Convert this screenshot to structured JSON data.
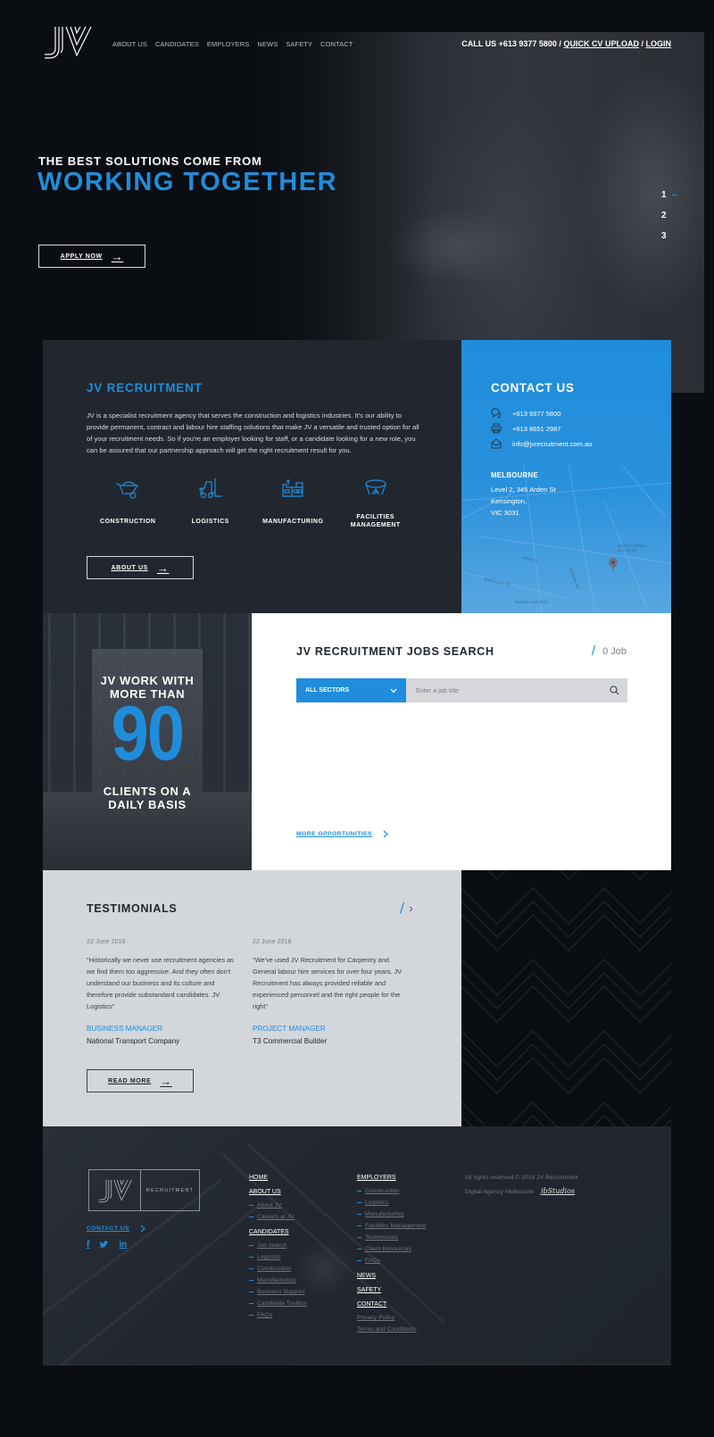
{
  "header": {
    "logo_text": "JV",
    "nav": [
      "ABOUT US",
      "CANDIDATES",
      "EMPLOYERS",
      "NEWS",
      "SAFETY",
      "CONTACT"
    ],
    "call_label": "CALL US +613 9377 5800",
    "separator": "/",
    "quick_cv_label": "QUICK CV UPLOAD",
    "login_label": "LOGIN"
  },
  "hero": {
    "subtitle": "THE BEST SOLUTIONS COME FROM",
    "title": "WORKING TOGETHER",
    "apply_label": "APPLY NOW",
    "slides": [
      "1",
      "2",
      "3"
    ],
    "active_slide": 1
  },
  "about": {
    "title": "JV RECRUITMENT",
    "text": "JV is a specialist recruitment agency that serves the construction and logistics industries. It's our ability to provide permanent, contract and labour hire staffing solutions that make JV a versatile and trusted option for all of your recruitment needs. So if you're an employer looking for staff, or a candidate looking for a new role, you can be assured that our partnership approach will get the right recruitment result for you.",
    "sectors": [
      {
        "label": "CONSTRUCTION",
        "icon": "wheelbarrow-icon"
      },
      {
        "label": "LOGISTICS",
        "icon": "forklift-icon"
      },
      {
        "label": "MANUFACTURING",
        "icon": "factory-icon"
      },
      {
        "label": "FACILITIES MANAGEMENT",
        "icon": "facilities-icon"
      }
    ],
    "button_label": "ABOUT US"
  },
  "contact": {
    "title": "CONTACT US",
    "phone": "+613 9377 5800",
    "fax": "+613 8651 2987",
    "email": "info@jvrecruitment.com.au",
    "city": "MELBOURNE",
    "address": [
      "Level 2, 345 Arden St",
      "Kensington,",
      "VIC 3031"
    ],
    "map_labels": [
      "Northern Brakes and Clutch",
      "Wishart Auto Tech",
      "Bakehouse Rd",
      "McClure Rd",
      "Arden St"
    ]
  },
  "stats": {
    "top": [
      "JV WORK WITH",
      "MORE THAN"
    ],
    "number": "90",
    "bottom": [
      "CLIENTS ON A",
      "DAILY BASIS"
    ]
  },
  "jobs": {
    "title": "JV RECRUITMENT JOBS SEARCH",
    "count": "0 Job",
    "sector_select": "ALL SECTORS",
    "search_placeholder": "Enter a job title",
    "search_value": "",
    "more_label": "MORE OPPORTUNITIES"
  },
  "testimonials": {
    "title": "TESTIMONIALS",
    "items": [
      {
        "date": "22 June 2016",
        "quote": "\"Historically we never use recruitment agencies as we find them too aggressive. And they often don't understand our business and its culture and therefore provide substandard candidates. JV Logistics\"",
        "role": "BUSINESS MANAGER",
        "company": "National Transport Company"
      },
      {
        "date": "22 June 2016",
        "quote": "\"We've used JV Recruitment for Carpentry and General labour hire services for over four years. JV Recruitment has always provided reliable and experienced personnel and the right people for the right\"",
        "role": "PROJECT MANAGER",
        "company": "T3 Commercial Builder"
      }
    ],
    "read_more_label": "READ MORE"
  },
  "footer": {
    "logo_word": "RECRUITMENT",
    "contact_label": "CONTACT US",
    "socials": [
      "f",
      "t",
      "in"
    ],
    "col1": {
      "home": "HOME",
      "about": "ABOUT US",
      "about_items": [
        "About JV",
        "Careers at JV"
      ],
      "candidates": "CANDIDATES",
      "candidate_items": [
        "Job search",
        "Logistics",
        "Construction",
        "Manufacturing",
        "Business Support",
        "Candidate Toolbox",
        "FAQs"
      ]
    },
    "col2": {
      "employers": "EMPLOYERS",
      "employer_items": [
        "Construction",
        "Logistics",
        "Manufacturing",
        "Facilities Management",
        "Testimonials",
        "Client Resources",
        "FAQs"
      ],
      "news": "NEWS",
      "safety": "SAFETY",
      "contact": "CONTACT",
      "privacy": "Privacy Policy",
      "terms": "Terms and Conditions"
    },
    "copyright": "All rights reserved © 2016 JV Recruitment",
    "agency_label": "Digital Agency Melbourne",
    "agency_name": "jbStudios"
  },
  "colors": {
    "accent": "#1f8ddb",
    "dark": "#22272f",
    "background": "#0a0d11",
    "light_panel": "#d3d6da"
  }
}
